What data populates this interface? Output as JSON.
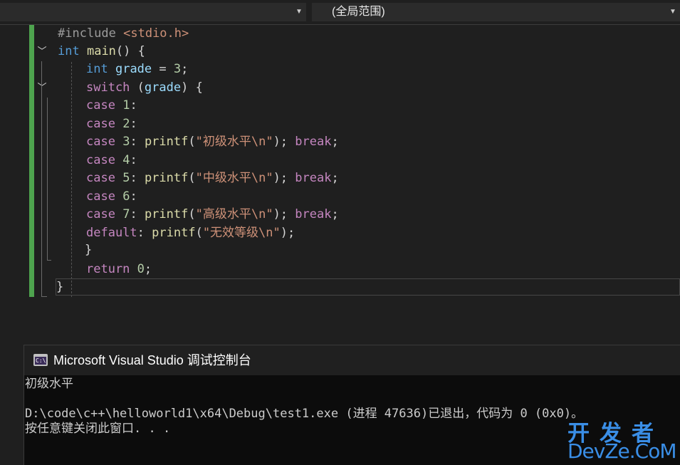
{
  "navbar": {
    "left_dropdown_value": "",
    "right_dropdown_value": "(全局范围)"
  },
  "editor": {
    "lines": [
      {
        "t1": "#include ",
        "t2": "<stdio.h>"
      },
      {
        "kw": "int",
        "fn": "main",
        "rest": "() {"
      },
      {
        "kw": "int",
        "var": "grade",
        "op": " = ",
        "num": "3",
        "end": ";"
      },
      {
        "kw": "switch",
        "open": " (",
        "var": "grade",
        "close": ") {"
      },
      {
        "kw": "case",
        "num": "1",
        "end": ":"
      },
      {
        "kw": "case",
        "num": "2",
        "end": ":"
      },
      {
        "kw": "case",
        "num": "3",
        "end": ": ",
        "fn": "printf",
        "p1": "(",
        "str": "\"初级水平\\n\"",
        "p2": "); ",
        "brk": "break",
        "semi": ";"
      },
      {
        "kw": "case",
        "num": "4",
        "end": ":"
      },
      {
        "kw": "case",
        "num": "5",
        "end": ": ",
        "fn": "printf",
        "p1": "(",
        "str": "\"中级水平\\n\"",
        "p2": "); ",
        "brk": "break",
        "semi": ";"
      },
      {
        "kw": "case",
        "num": "6",
        "end": ":"
      },
      {
        "kw": "case",
        "num": "7",
        "end": ": ",
        "fn": "printf",
        "p1": "(",
        "str": "\"高级水平\\n\"",
        "p2": "); ",
        "brk": "break",
        "semi": ";"
      },
      {
        "kw": "default",
        "end": ": ",
        "fn": "printf",
        "p1": "(",
        "str": "\"无效等级\\n\"",
        "p2": ");"
      },
      {
        "text": "}"
      },
      {
        "kw": "return",
        "num": "0",
        "end": ";"
      },
      {
        "text": "}"
      }
    ]
  },
  "console": {
    "title": "Microsoft Visual Studio 调试控制台",
    "icon_label": "C:\\",
    "lines": [
      "初级水平",
      "",
      "D:\\code\\c++\\helloworld1\\x64\\Debug\\test1.exe (进程 47636)已退出，代码为 0 (0x0)。",
      "按任意键关闭此窗口. . ."
    ]
  },
  "watermark": {
    "cn": "开发者",
    "en": "DevZe.CoM"
  },
  "colors": {
    "keyword": "#569cd6",
    "control": "#c586c0",
    "function": "#dcdcaa",
    "string": "#ce9178",
    "number": "#b5cea8",
    "variable": "#9cdcfe",
    "change_bar": "#4ea34e",
    "watermark": "#3a8ee6"
  },
  "icons": [
    "chevron-down-icon",
    "fold-chevron-icon",
    "console-app-icon"
  ]
}
